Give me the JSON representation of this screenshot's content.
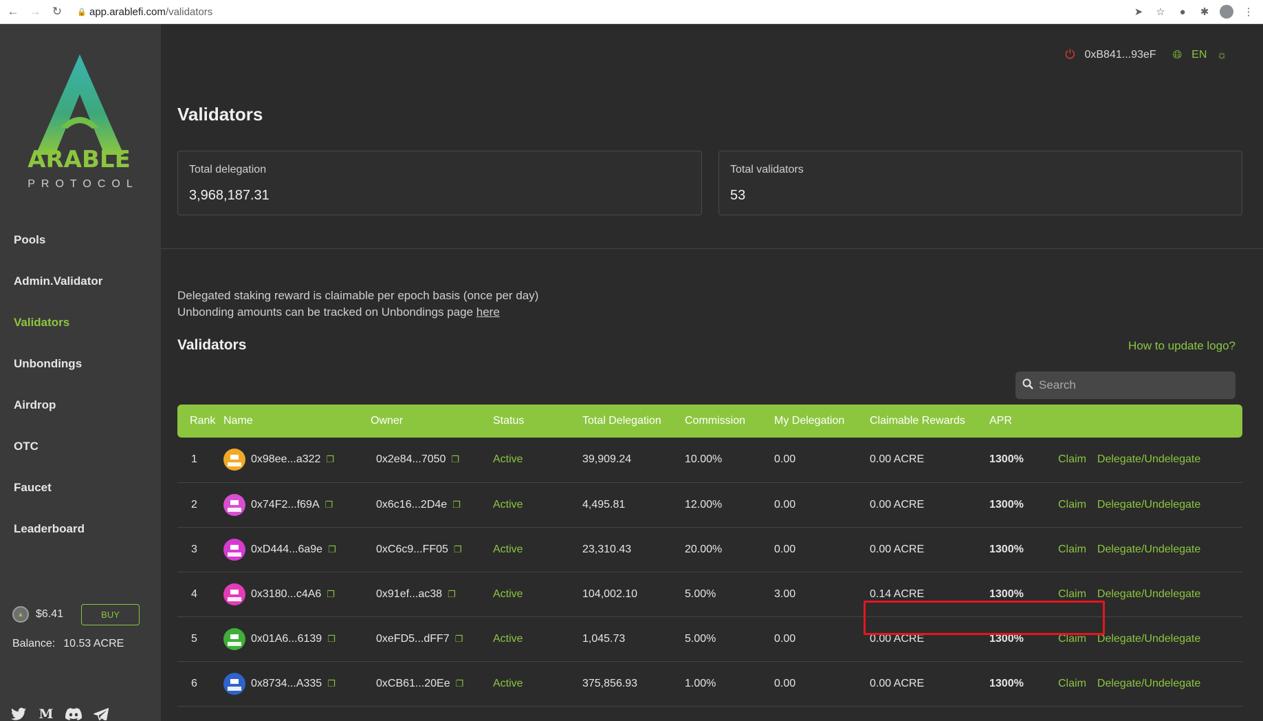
{
  "browser": {
    "url_host": "app.arablefi.com",
    "url_path": "/validators"
  },
  "sidebar": {
    "logo_text": "PROTOCOL",
    "nav": [
      {
        "label": "Pools"
      },
      {
        "label": "Admin.Validator"
      },
      {
        "label": "Validators",
        "active": true
      },
      {
        "label": "Unbondings"
      },
      {
        "label": "Airdrop"
      },
      {
        "label": "OTC"
      },
      {
        "label": "Faucet"
      },
      {
        "label": "Leaderboard"
      }
    ],
    "price": "$6.41",
    "buy_label": "BUY",
    "balance_label": "Balance:",
    "balance_value": "10.53 ACRE",
    "socials": [
      "twitter-icon",
      "medium-icon",
      "discord-icon",
      "telegram-icon"
    ]
  },
  "header": {
    "wallet": "0xB841...93eF",
    "language": "EN"
  },
  "page_title": "Validators",
  "stats": {
    "total_delegation_label": "Total delegation",
    "total_delegation_value": "3,968,187.31",
    "total_validators_label": "Total validators",
    "total_validators_value": "53"
  },
  "notes": {
    "line1": "Delegated staking reward is claimable per epoch basis (once per day)",
    "line2": "Unbonding amounts can be tracked on Unbondings page",
    "link": "here"
  },
  "section_title": "Validators",
  "how_to_link": "How to update logo?",
  "search": {
    "placeholder": "Search"
  },
  "table": {
    "headers": {
      "rank": "Rank",
      "name": "Name",
      "owner": "Owner",
      "status": "Status",
      "total_delegation": "Total Delegation",
      "commission": "Commission",
      "my_delegation": "My Delegation",
      "claimable_rewards": "Claimable Rewards",
      "apr": "APR"
    },
    "claim_label": "Claim",
    "delegate_label": "Delegate/Undelegate",
    "rows": [
      {
        "rank": "1",
        "name": "0x98ee...a322",
        "owner": "0x2e84...7050",
        "status": "Active",
        "total_delegation": "39,909.24",
        "commission": "10.00%",
        "my_delegation": "0.00",
        "claimable_rewards": "0.00 ACRE",
        "apr": "1300%",
        "avatar_color": "#f2a826"
      },
      {
        "rank": "2",
        "name": "0x74F2...f69A",
        "owner": "0x6c16...2D4e",
        "status": "Active",
        "total_delegation": "4,495.81",
        "commission": "12.00%",
        "my_delegation": "0.00",
        "claimable_rewards": "0.00 ACRE",
        "apr": "1300%",
        "avatar_color": "#d84fcf"
      },
      {
        "rank": "3",
        "name": "0xD444...6a9e",
        "owner": "0xC6c9...FF05",
        "status": "Active",
        "total_delegation": "23,310.43",
        "commission": "20.00%",
        "my_delegation": "0.00",
        "claimable_rewards": "0.00 ACRE",
        "apr": "1300%",
        "avatar_color": "#d63bd1"
      },
      {
        "rank": "4",
        "name": "0x3180...c4A6",
        "owner": "0x91ef...ac38",
        "status": "Active",
        "total_delegation": "104,002.10",
        "commission": "5.00%",
        "my_delegation": "3.00",
        "claimable_rewards": "0.14 ACRE",
        "apr": "1300%",
        "avatar_color": "#e33cb8"
      },
      {
        "rank": "5",
        "name": "0x01A6...6139",
        "owner": "0xeFD5...dFF7",
        "status": "Active",
        "total_delegation": "1,045.73",
        "commission": "5.00%",
        "my_delegation": "0.00",
        "claimable_rewards": "0.00 ACRE",
        "apr": "1300%",
        "avatar_color": "#3fae3a"
      },
      {
        "rank": "6",
        "name": "0x8734...A335",
        "owner": "0xCB61...20Ee",
        "status": "Active",
        "total_delegation": "375,856.93",
        "commission": "1.00%",
        "my_delegation": "0.00",
        "claimable_rewards": "0.00 ACRE",
        "apr": "1300%",
        "avatar_color": "#2f63c9"
      }
    ]
  }
}
